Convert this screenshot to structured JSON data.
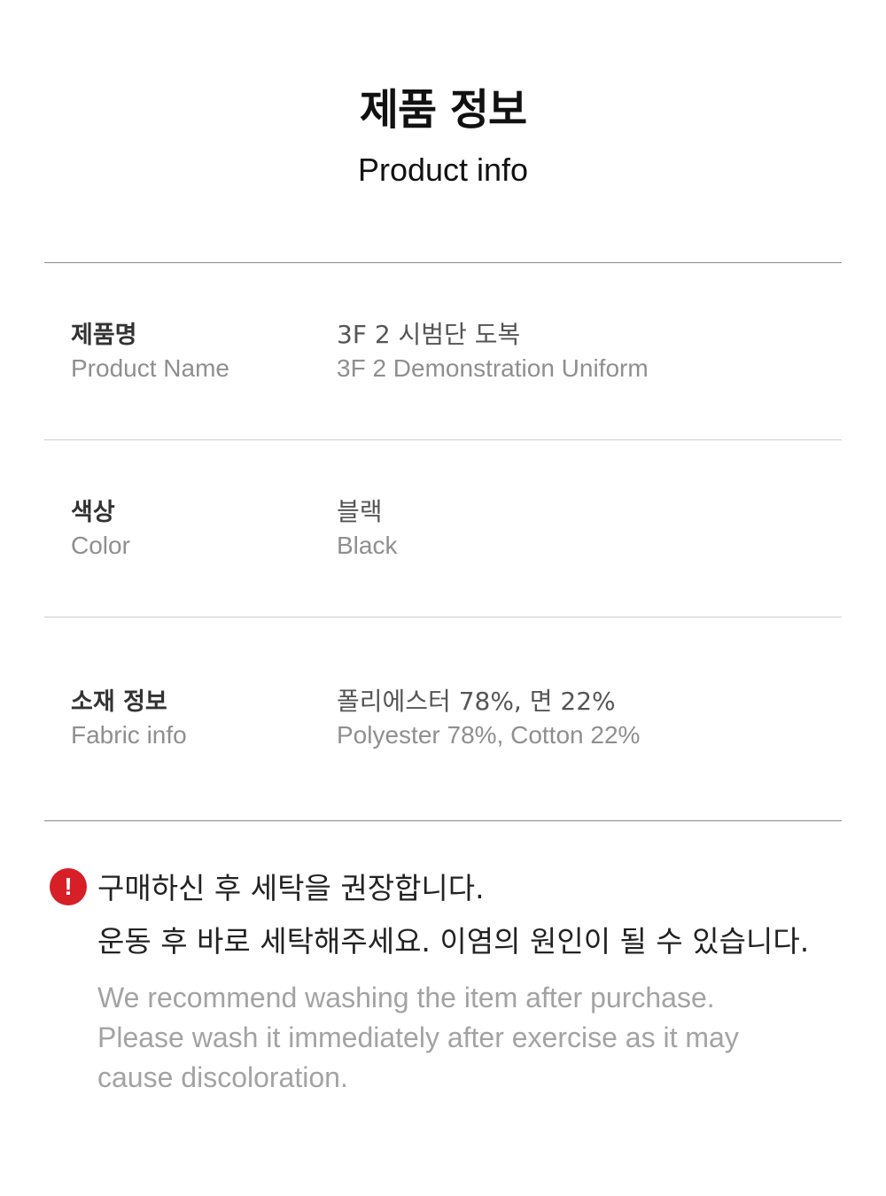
{
  "header": {
    "title_ko": "제품 정보",
    "title_en": "Product info"
  },
  "rows": [
    {
      "label_ko": "제품명",
      "label_en": "Product Name",
      "value_ko": "3F 2 시범단 도복",
      "value_en": "3F 2 Demonstration Uniform"
    },
    {
      "label_ko": "색상",
      "label_en": "Color",
      "value_ko": "블랙",
      "value_en": "Black"
    },
    {
      "label_ko": "소재 정보",
      "label_en": "Fabric info",
      "value_ko": "폴리에스터 78%, 면 22%",
      "value_en": "Polyester 78%, Cotton 22%"
    }
  ],
  "notice": {
    "icon": "exclamation-icon",
    "icon_glyph": "!",
    "icon_color": "#d61f26",
    "line_ko_1": "구매하신 후 세탁을 권장합니다.",
    "line_ko_2": "운동 후 바로 세탁해주세요. 이염의 원인이 될 수 있습니다.",
    "line_en_1": "We recommend washing the item after purchase.",
    "line_en_2": "Please wash it immediately after exercise as it may",
    "line_en_3": "cause discoloration."
  }
}
